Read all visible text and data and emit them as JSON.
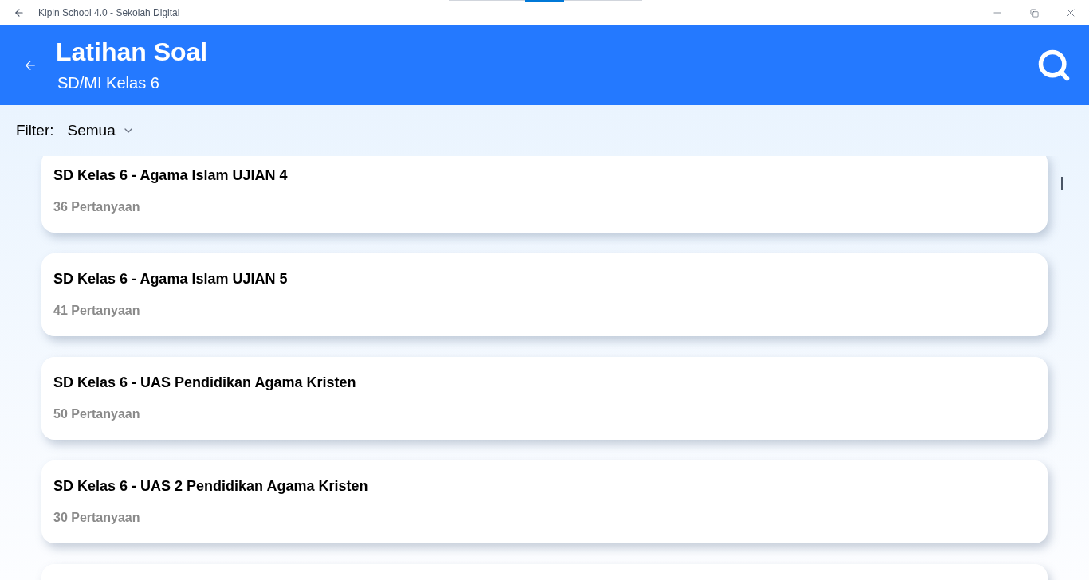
{
  "window": {
    "title": "Kipin School 4.0 - Sekolah Digital"
  },
  "header": {
    "title": "Latihan Soal",
    "subtitle": "SD/MI Kelas 6"
  },
  "filter": {
    "label": "Filter:",
    "value": "Semua"
  },
  "quizzes": [
    {
      "title": "SD Kelas 6 - Agama Islam UJIAN 4",
      "count": "36 Pertanyaan"
    },
    {
      "title": "SD Kelas 6 - Agama Islam UJIAN 5",
      "count": "41 Pertanyaan"
    },
    {
      "title": "SD Kelas 6 - UAS Pendidikan Agama Kristen",
      "count": "50 Pertanyaan"
    },
    {
      "title": "SD Kelas 6 - UAS 2 Pendidikan Agama Kristen",
      "count": "30 Pertanyaan"
    }
  ]
}
